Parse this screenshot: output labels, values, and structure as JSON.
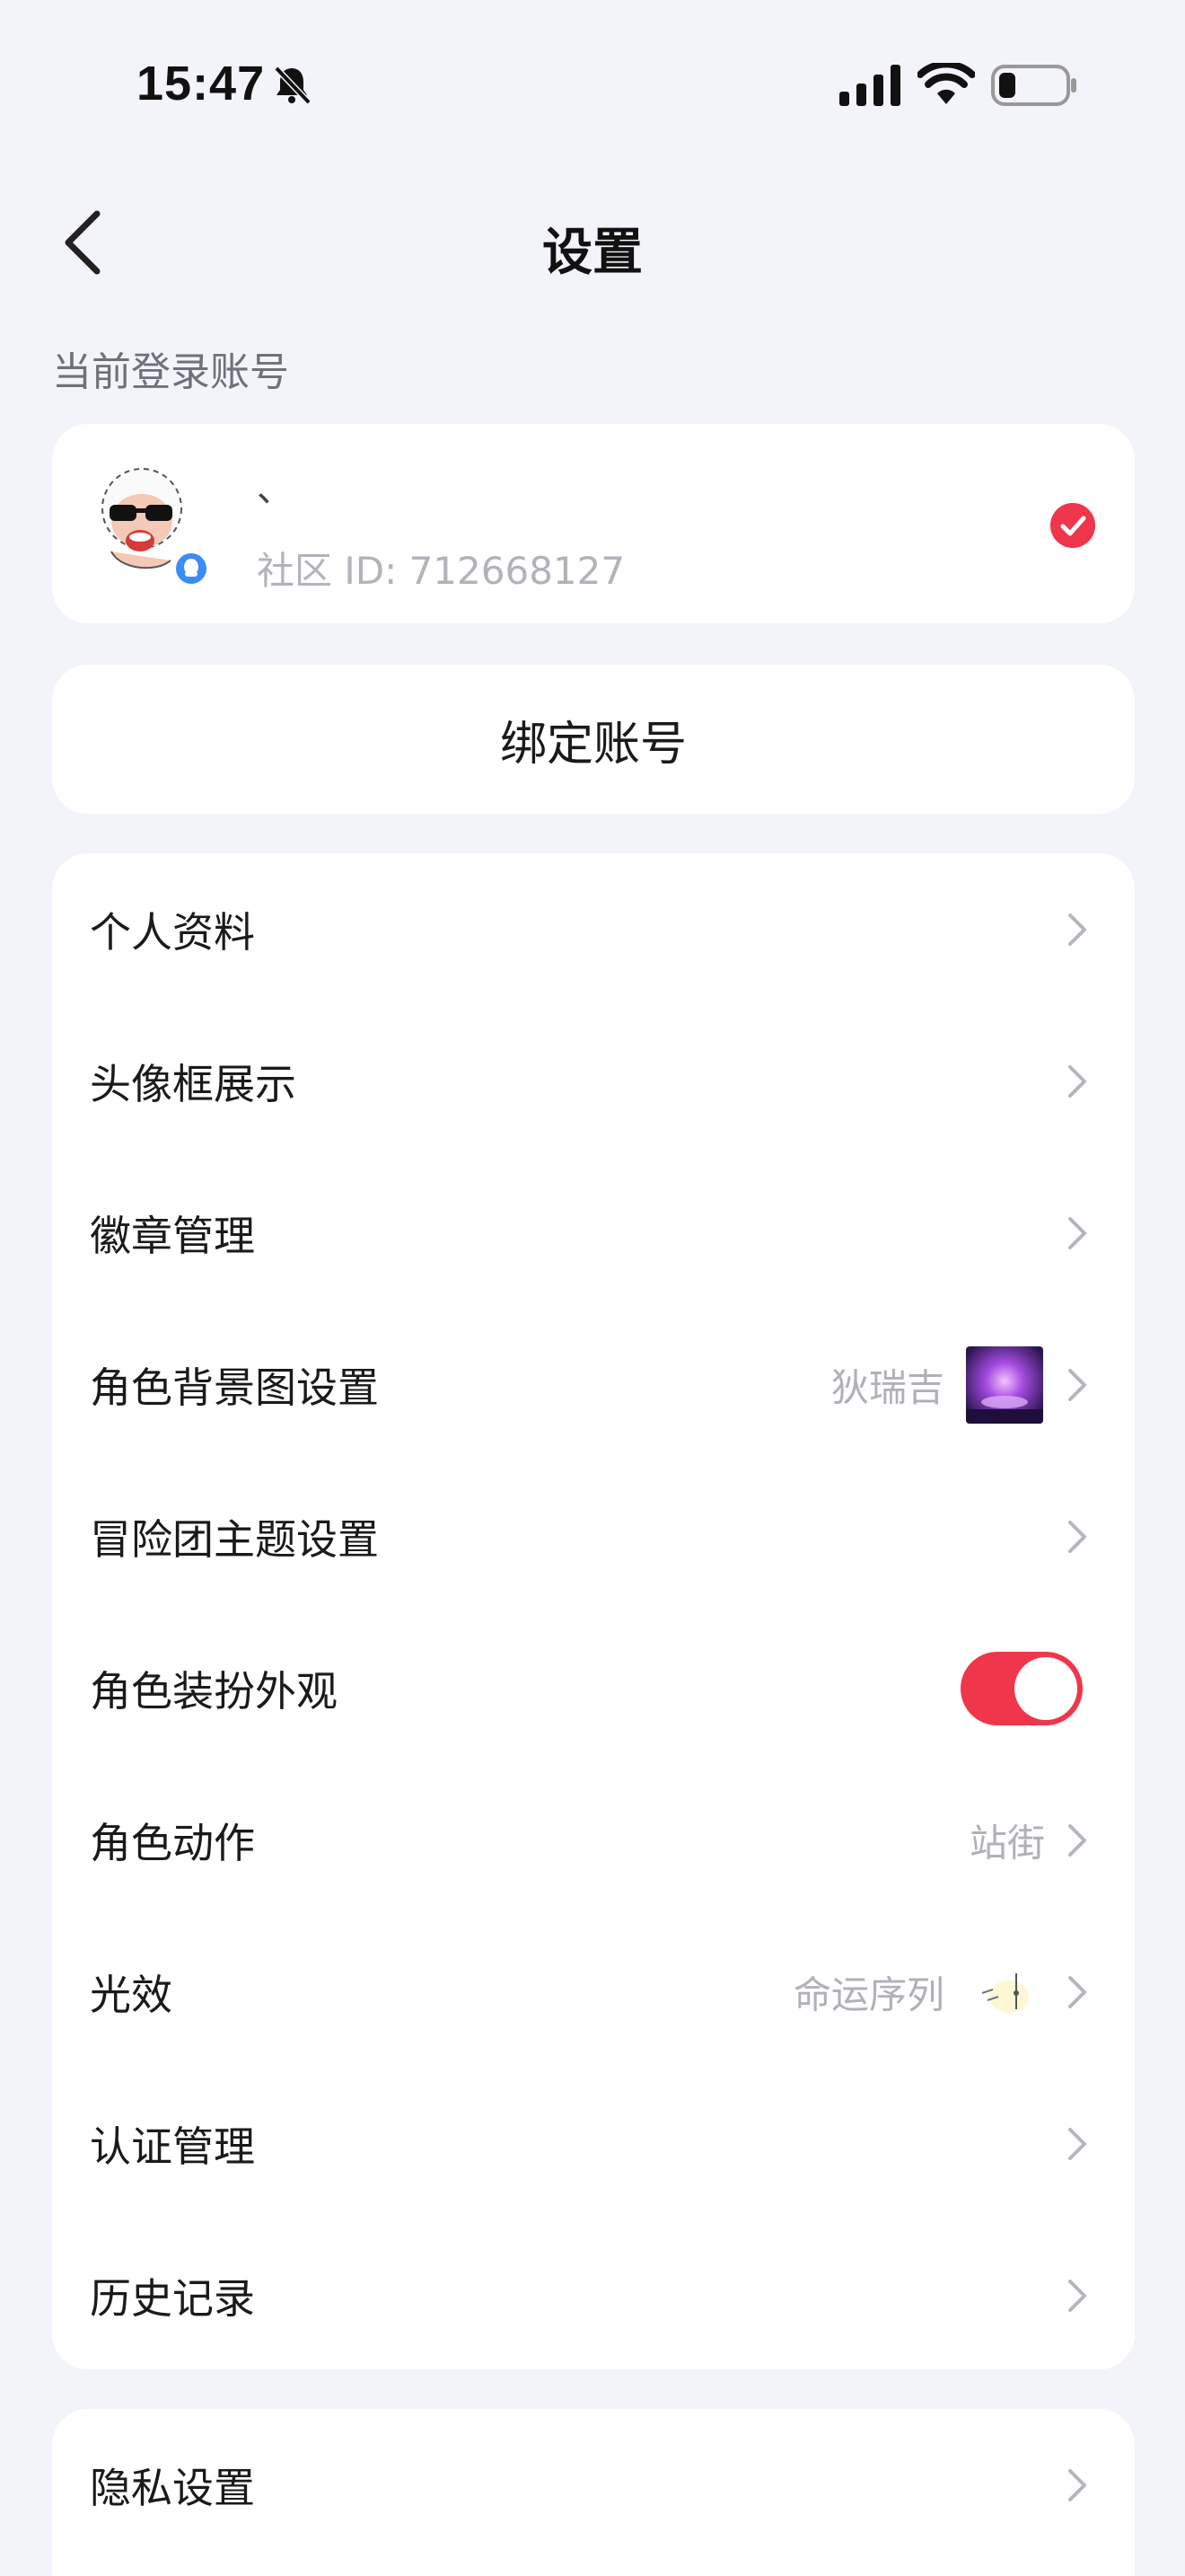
{
  "status_bar": {
    "time": "15:47"
  },
  "nav": {
    "title": "设置"
  },
  "account_section": {
    "label": "当前登录账号",
    "nickname": "、",
    "community_id": "社区 ID: 712668127"
  },
  "bind_account": {
    "label": "绑定账号"
  },
  "menu": {
    "items": [
      {
        "label": "个人资料"
      },
      {
        "label": "头像框展示"
      },
      {
        "label": "徽章管理"
      },
      {
        "label": "角色背景图设置",
        "value": "狄瑞吉"
      },
      {
        "label": "冒险团主题设置"
      },
      {
        "label": "角色装扮外观",
        "toggle": true
      },
      {
        "label": "角色动作",
        "value": "站街"
      },
      {
        "label": "光效",
        "value": "命运序列"
      },
      {
        "label": "认证管理"
      },
      {
        "label": "历史记录"
      }
    ]
  },
  "privacy": {
    "label": "隐私设置"
  },
  "colors": {
    "accent": "#f0364b",
    "background": "#f3f4f9",
    "card": "#ffffff",
    "secondary_text": "#b0b1b8"
  }
}
